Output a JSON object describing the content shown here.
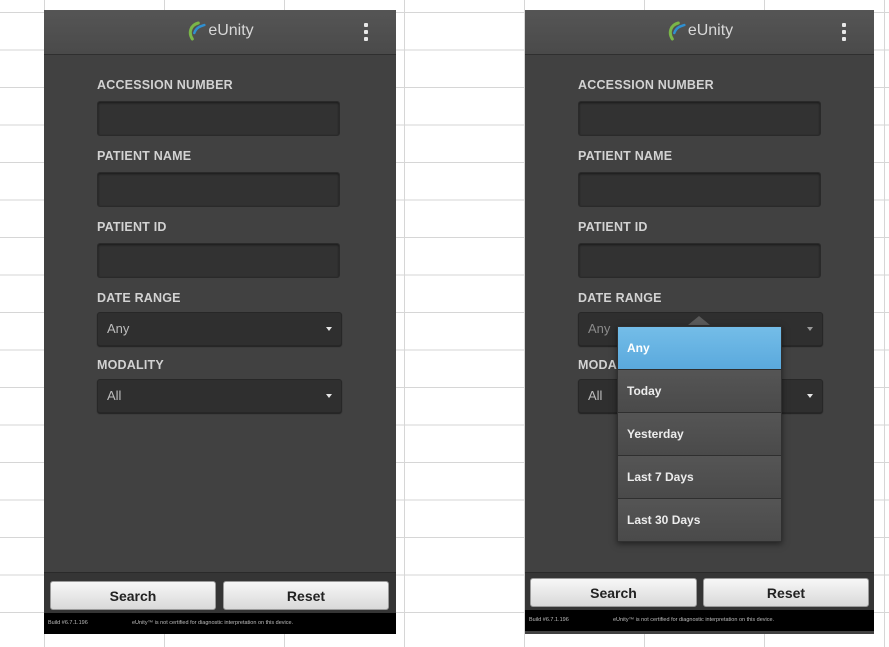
{
  "app": {
    "logo_text": "eUnity"
  },
  "form": {
    "accession_label": "ACCESSION NUMBER",
    "patient_name_label": "PATIENT NAME",
    "patient_id_label": "PATIENT ID",
    "date_range_label": "DATE RANGE",
    "date_range_value": "Any",
    "modality_label": "MODALITY",
    "modality_value": "All",
    "modality_label_partial": "MODA"
  },
  "buttons": {
    "search": "Search",
    "reset": "Reset"
  },
  "footer": {
    "build": "Build #6.7.1.196",
    "note": "eUnity™ is not certified for diagnostic interpretation on this device."
  },
  "date_range_options": [
    "Any",
    "Today",
    "Yesterday",
    "Last 7 Days",
    "Last 30 Days"
  ],
  "date_range_selected_index": 0,
  "colors": {
    "selected_option": "#5aa9dd",
    "logo_green": "#7ab648",
    "logo_blue": "#2f8fd0"
  }
}
